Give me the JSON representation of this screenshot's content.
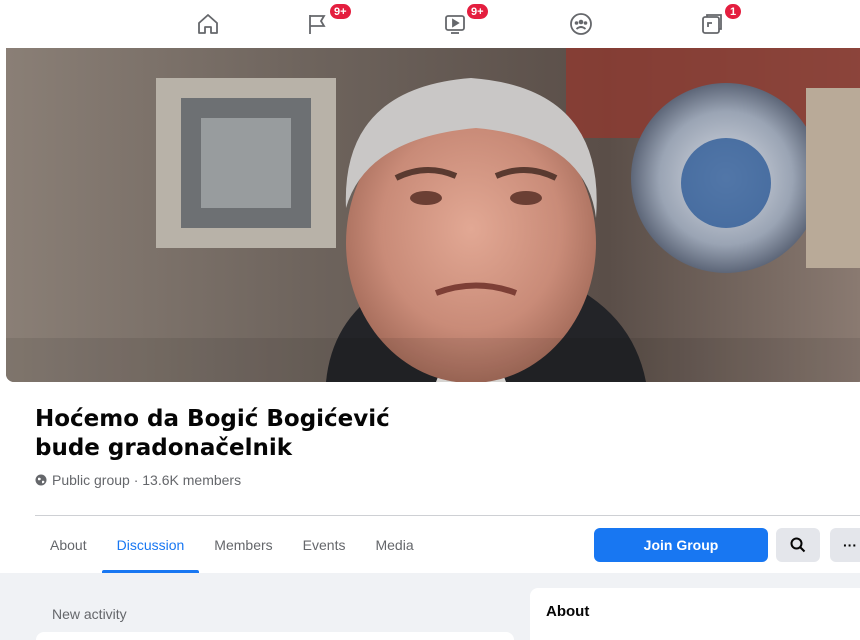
{
  "top_nav": {
    "items": [
      {
        "icon": "home-icon",
        "badge": ""
      },
      {
        "icon": "flag-icon",
        "badge": "9+"
      },
      {
        "icon": "watch-icon",
        "badge": "9+"
      },
      {
        "icon": "groups-icon",
        "badge": ""
      },
      {
        "icon": "gaming-icon",
        "badge": "1"
      }
    ]
  },
  "group": {
    "title": "Hoćemo da Bogić Bogićević bude gradonačelnik",
    "meta": "Public group · 13.6K members"
  },
  "tabs": [
    "About",
    "Discussion",
    "Members",
    "Events",
    "Media"
  ],
  "active_tab": "Discussion",
  "actions": {
    "join_label": "Join Group",
    "more_label": "···"
  },
  "feed": {
    "new_activity_label": "New activity"
  },
  "about_panel": {
    "title": "About"
  },
  "colors": {
    "accent": "#1877f2",
    "badge": "#e41e3f",
    "muted_text": "#65676b",
    "feed_background": "#f0f2f5"
  }
}
